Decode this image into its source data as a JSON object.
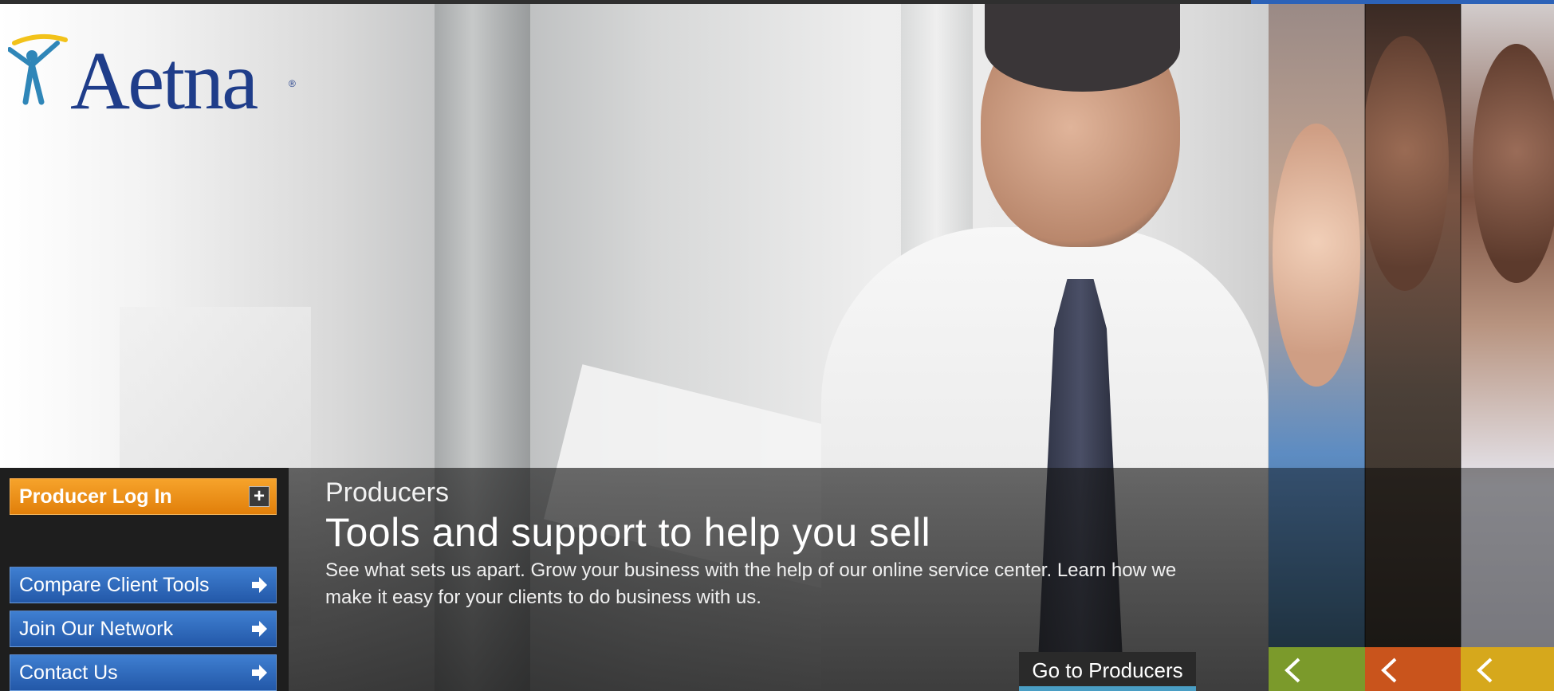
{
  "logo": {
    "text": "Aetna",
    "reg": "®"
  },
  "left_nav": {
    "login_label": "Producer Log In",
    "login_icon": "plus-icon",
    "links": [
      {
        "label": "Compare Client Tools",
        "icon": "arrow-right-icon"
      },
      {
        "label": "Join Our Network",
        "icon": "arrow-right-icon"
      },
      {
        "label": "Contact Us",
        "icon": "arrow-right-icon"
      }
    ]
  },
  "feature": {
    "kicker": "Producers",
    "headline": "Tools and support to help you sell",
    "description": "See what sets us apart. Grow your business with the help of our online service center. Learn how we make it easy for your clients to do business with us.",
    "cta_label": "Go to Producers"
  },
  "side_panels": [
    {
      "icon": "chevron-left-icon",
      "color": "#7b9a2b"
    },
    {
      "icon": "chevron-left-icon",
      "color": "#c9541c"
    },
    {
      "icon": "chevron-left-icon",
      "color": "#d6a81c"
    }
  ],
  "colors": {
    "brand_blue": "#1f3d8a",
    "login_orange": "#e88a12",
    "nav_blue": "#2d69bd",
    "cta_underline": "#4a9ec4"
  }
}
